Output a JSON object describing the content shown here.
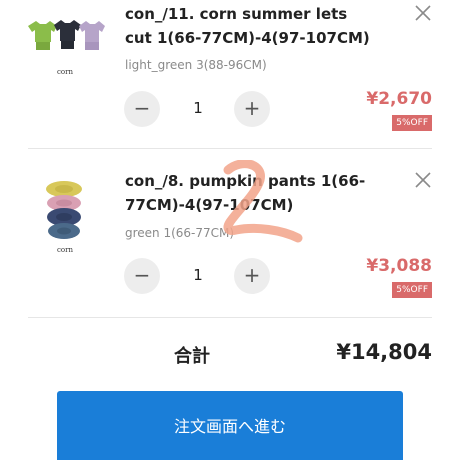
{
  "cart": {
    "items": [
      {
        "name": "con_/11. corn summer lets cut 1(66-77CM)-4(97-107CM)",
        "variant": "light_green 3(88-96CM)",
        "quantity": "1",
        "price": "¥2,670",
        "discount": "5%OFF",
        "image_caption": "corn",
        "image_icon": "tshirt-shorts-set-icon"
      },
      {
        "name": "con_/8. pumpkin pants 1(66-77CM)-4(97-107CM)",
        "variant": "green 1(66-77CM)",
        "quantity": "1",
        "price": "¥3,088",
        "discount": "5%OFF",
        "image_caption": "corn",
        "image_icon": "pumpkin-pants-icon"
      }
    ],
    "controls": {
      "minus_label": "−",
      "plus_label": "+"
    }
  },
  "summary": {
    "total_label": "合計",
    "total_value": "¥14,804"
  },
  "checkout": {
    "button_label": "注文画面へ進む"
  },
  "colors": {
    "price": "#d96a6a",
    "discount_bg": "#d96a6a",
    "checkout_bg": "#1a7ed8",
    "qty_button_bg": "#ededed",
    "annotation": "#f2a38a"
  }
}
